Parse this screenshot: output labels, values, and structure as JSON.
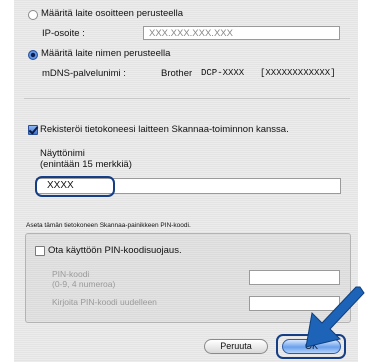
{
  "options": {
    "by_address": {
      "label": "Määritä laite osoitteen perusteella",
      "selected": false,
      "ip_label": "IP-osoite :",
      "ip_value": "XXX.XXX.XXX.XXX"
    },
    "by_name": {
      "label": "Määritä laite nimen perusteella",
      "selected": true,
      "mdns_label": "mDNS-palvelunimi :",
      "mdns_prefix": "Brother",
      "mdns_model": "DCP-XXXX",
      "mdns_suffix": "[XXXXXXXXXXXX]"
    }
  },
  "register": {
    "label": "Rekisteröi tietokoneesi laitteen Skannaa-toiminnon kanssa.",
    "checked": true
  },
  "display_name": {
    "label_line1": "Näyttönimi",
    "label_line2": "(enintään 15 merkkiä)",
    "value": "XXXX"
  },
  "pin": {
    "section_label": "Aseta tämän tietokoneen Skannaa-painikkeen PIN-koodi.",
    "enable_label": "Ota käyttöön PIN-koodisuojaus.",
    "enabled": false,
    "code_label_line1": "PIN-koodi",
    "code_label_line2": "(0-9, 4 numeroa)",
    "confirm_label": "Kirjoita PIN-koodi uudelleen",
    "code_value": "",
    "confirm_value": ""
  },
  "buttons": {
    "cancel": "Peruuta",
    "ok": "OK"
  },
  "colors": {
    "arrow": "#1d63b8",
    "highlight_ring": "#163e86",
    "default_button": "#6aa0ec"
  }
}
